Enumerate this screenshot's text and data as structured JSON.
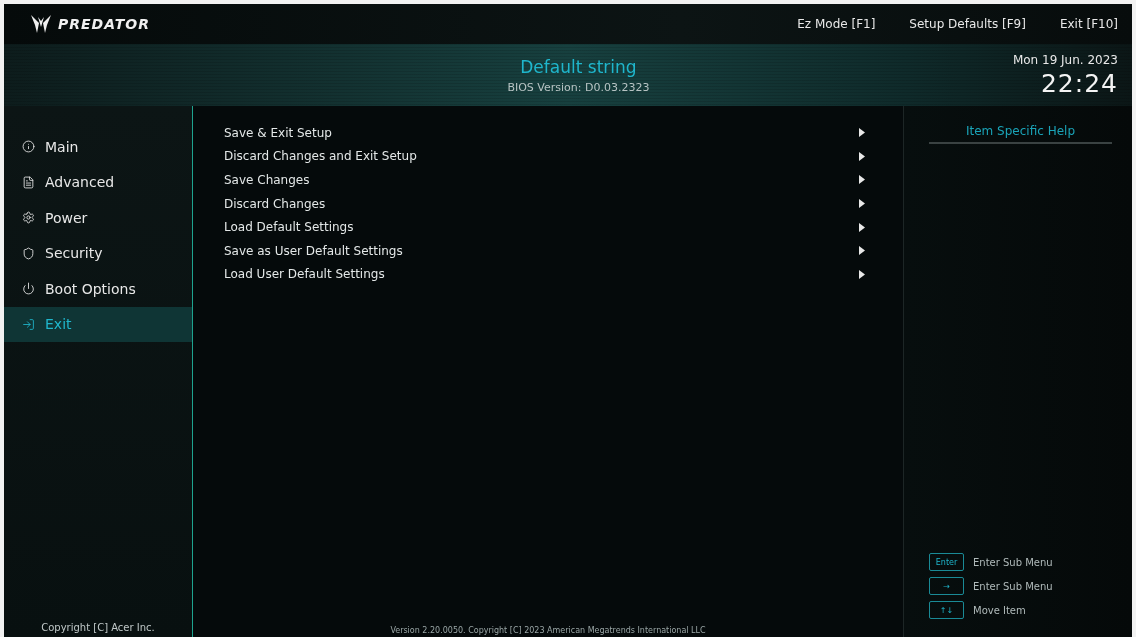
{
  "brand": "PREDATOR",
  "top_links": [
    {
      "label": "Ez Mode [F1]"
    },
    {
      "label": "Setup Defaults [F9]"
    },
    {
      "label": "Exit [F10]"
    }
  ],
  "header": {
    "title": "Default string",
    "bios_version": "BIOS Version: D0.03.2323",
    "date": "Mon 19 Jun. 2023",
    "time": "22:24"
  },
  "sidebar": {
    "items": [
      {
        "label": "Main",
        "selected": false
      },
      {
        "label": "Advanced",
        "selected": false
      },
      {
        "label": "Power",
        "selected": false
      },
      {
        "label": "Security",
        "selected": false
      },
      {
        "label": "Boot Options",
        "selected": false
      },
      {
        "label": "Exit",
        "selected": true
      }
    ],
    "copyright": "Copyright [C] Acer Inc."
  },
  "menu": [
    {
      "label": "Save & Exit Setup"
    },
    {
      "label": "Discard Changes and Exit Setup"
    },
    {
      "label": "Save Changes"
    },
    {
      "label": "Discard Changes"
    },
    {
      "label": "Load Default Settings"
    },
    {
      "label": "Save as User Default Settings"
    },
    {
      "label": "Load User Default Settings"
    }
  ],
  "footer": "Version 2.20.0050. Copyright [C] 2023 American Megatrends International LLC",
  "help": {
    "title": "Item Specific Help",
    "keys": [
      {
        "key": "Enter",
        "action": "Enter Sub Menu"
      },
      {
        "key": "→",
        "action": "Enter Sub Menu"
      },
      {
        "key": "↑↓",
        "action": "Move Item"
      }
    ]
  }
}
